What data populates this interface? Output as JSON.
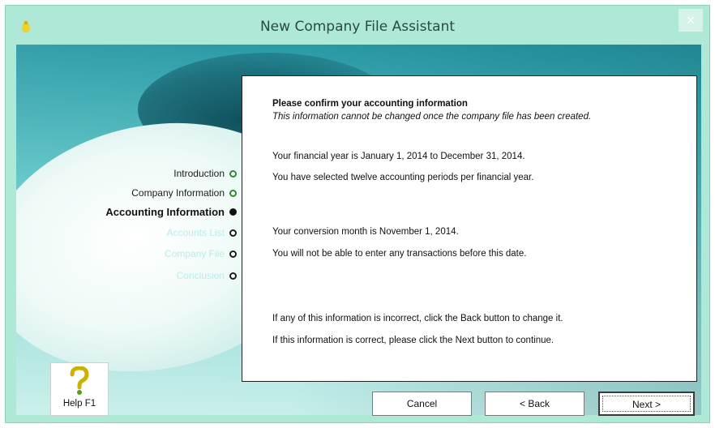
{
  "window": {
    "title": "New Company File Assistant",
    "close_glyph": "×",
    "accent": "#aee8d6"
  },
  "steps": [
    {
      "label": "Introduction",
      "state": "done"
    },
    {
      "label": "Company Information",
      "state": "done"
    },
    {
      "label": "Accounting Information",
      "state": "current"
    },
    {
      "label": "Accounts List",
      "state": "future"
    },
    {
      "label": "Company File",
      "state": "future"
    },
    {
      "label": "Conclusion",
      "state": "future"
    }
  ],
  "panel": {
    "heading": "Please confirm your accounting information",
    "subheading": "This information cannot be changed once the company file has been created.",
    "lines": [
      "Your financial year is January 1, 2014 to December 31, 2014.",
      "You have selected twelve accounting periods per financial year.",
      "Your conversion month is November 1, 2014.",
      "You will not be able to enter any transactions before this date.",
      "If any of this information is incorrect, click the Back button to change it.",
      "If this information is correct, please click the Next button to continue."
    ]
  },
  "help": {
    "label": "Help F1"
  },
  "buttons": {
    "cancel": "Cancel",
    "back": "< Back",
    "next": "Next >"
  }
}
